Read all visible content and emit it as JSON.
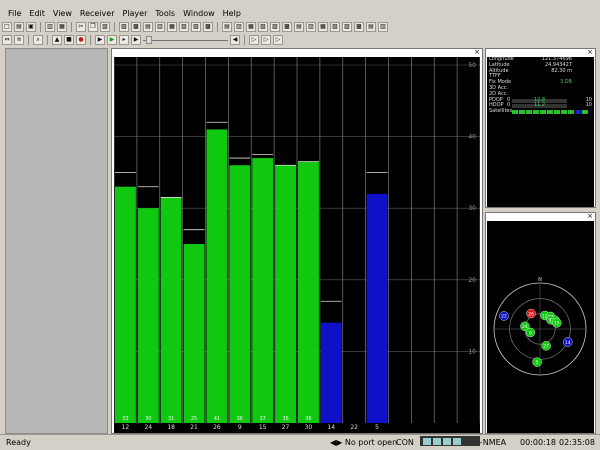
{
  "menu": [
    "File",
    "Edit",
    "View",
    "Receiver",
    "Player",
    "Tools",
    "Window",
    "Help"
  ],
  "toolbar1": [
    {
      "icon": "new-icon",
      "glyph": "□",
      "c": ""
    },
    {
      "icon": "open-icon",
      "glyph": "▤",
      "c": ""
    },
    {
      "icon": "save-icon",
      "glyph": "▣",
      "c": ""
    },
    {
      "sep": true
    },
    {
      "icon": "print-icon",
      "glyph": "▥",
      "c": ""
    },
    {
      "icon": "preview-icon",
      "glyph": "▦",
      "c": ""
    },
    {
      "sep": true
    },
    {
      "icon": "cut-icon",
      "glyph": "✂",
      "c": ""
    },
    {
      "icon": "copy-icon",
      "glyph": "❐",
      "c": ""
    },
    {
      "icon": "paste-icon",
      "glyph": "▧",
      "c": ""
    },
    {
      "sep": true
    },
    {
      "icon": "view1-icon",
      "glyph": "▨",
      "c": ""
    },
    {
      "icon": "view2-icon",
      "glyph": "▩",
      "c": ""
    },
    {
      "icon": "view3-icon",
      "glyph": "▤",
      "c": ""
    },
    {
      "icon": "view4-icon",
      "glyph": "▥",
      "c": ""
    },
    {
      "icon": "view5-icon",
      "glyph": "▦",
      "c": ""
    },
    {
      "icon": "view6-icon",
      "glyph": "▧",
      "c": ""
    },
    {
      "icon": "view7-icon",
      "glyph": "▨",
      "c": ""
    },
    {
      "icon": "view8-icon",
      "glyph": "▩",
      "c": ""
    },
    {
      "sep": true
    },
    {
      "icon": "tile1-icon",
      "glyph": "▤",
      "c": ""
    },
    {
      "icon": "tile2-icon",
      "glyph": "▥",
      "c": ""
    },
    {
      "icon": "tile3-icon",
      "glyph": "▦",
      "c": ""
    },
    {
      "icon": "tile4-icon",
      "glyph": "▧",
      "c": ""
    },
    {
      "icon": "tile5-icon",
      "glyph": "▨",
      "c": ""
    },
    {
      "icon": "tile6-icon",
      "glyph": "▩",
      "c": ""
    },
    {
      "icon": "tile7-icon",
      "glyph": "▤",
      "c": ""
    },
    {
      "icon": "tile8-icon",
      "glyph": "▥",
      "c": ""
    },
    {
      "icon": "tile9-icon",
      "glyph": "▦",
      "c": ""
    },
    {
      "icon": "tile10-icon",
      "glyph": "▧",
      "c": ""
    },
    {
      "icon": "tile11-icon",
      "glyph": "▨",
      "c": ""
    },
    {
      "icon": "tile12-icon",
      "glyph": "▩",
      "c": ""
    },
    {
      "icon": "tile13-icon",
      "glyph": "▤",
      "c": ""
    },
    {
      "icon": "tile14-icon",
      "glyph": "▥",
      "c": ""
    }
  ],
  "toolbar2": [
    {
      "icon": "connect-icon",
      "glyph": "⇔",
      "c": ""
    },
    {
      "icon": "baud-icon",
      "glyph": "≋",
      "c": ""
    },
    {
      "sep": true
    },
    {
      "icon": "search-icon",
      "glyph": "⌕",
      "c": ""
    },
    {
      "sep": true
    },
    {
      "icon": "eject-icon",
      "glyph": "▲",
      "c": "k"
    },
    {
      "icon": "stop-icon",
      "glyph": "■",
      "c": "k"
    },
    {
      "icon": "record-icon",
      "glyph": "●",
      "c": "r"
    },
    {
      "sep": true
    },
    {
      "icon": "step-icon",
      "glyph": "▶",
      "c": "k"
    },
    {
      "icon": "play-icon",
      "glyph": "▶",
      "c": "g"
    },
    {
      "icon": "fast-forward-icon",
      "glyph": "▸",
      "c": "k"
    },
    {
      "icon": "skip-icon",
      "glyph": "▶",
      "c": "k"
    }
  ],
  "toolbar2_tail": [
    {
      "icon": "rewind-icon",
      "glyph": "◀",
      "c": "k"
    },
    {
      "sep": true
    },
    {
      "icon": "marker1-icon",
      "glyph": "▷",
      "c": "k"
    },
    {
      "icon": "marker2-icon",
      "glyph": "▷",
      "c": "k"
    },
    {
      "icon": "marker3-icon",
      "glyph": "▷",
      "c": "k"
    }
  ],
  "colors": {
    "green": "#10c810",
    "blue": "#1010c8",
    "grid": "#6d6d6d"
  },
  "snr": {
    "axis_labels": [
      "50",
      "40",
      "30",
      "20",
      "10"
    ],
    "max": 50,
    "satellites": [
      {
        "prn": "12",
        "snr": 33,
        "peak": 35,
        "color": "green",
        "label": "33"
      },
      {
        "prn": "24",
        "snr": 30,
        "peak": 33,
        "color": "green",
        "label": "30"
      },
      {
        "prn": "18",
        "snr": 31.5,
        "peak": 31.5,
        "color": "green",
        "label": "31"
      },
      {
        "prn": "21",
        "snr": 25,
        "peak": 27,
        "color": "green",
        "label": "25"
      },
      {
        "prn": "26",
        "snr": 41,
        "peak": 42,
        "color": "green",
        "label": "41"
      },
      {
        "prn": "9",
        "snr": 36,
        "peak": 37,
        "color": "green",
        "label": "36"
      },
      {
        "prn": "15",
        "snr": 37,
        "peak": 37.5,
        "color": "green",
        "label": "37"
      },
      {
        "prn": "27",
        "snr": 36,
        "peak": 36,
        "color": "green",
        "label": "36"
      },
      {
        "prn": "30",
        "snr": 36.5,
        "peak": 36.5,
        "color": "green",
        "label": "36"
      },
      {
        "prn": "14",
        "snr": 14,
        "peak": 17,
        "color": "blue",
        "label": ""
      },
      {
        "prn": "22",
        "snr": 0,
        "peak": 0,
        "color": "blue",
        "label": ""
      },
      {
        "prn": "5",
        "snr": 32,
        "peak": 35,
        "color": "blue",
        "label": ""
      },
      {
        "prn": "",
        "snr": 0,
        "peak": 0,
        "color": "blue",
        "label": ""
      },
      {
        "prn": "",
        "snr": 0,
        "peak": 0,
        "color": "blue",
        "label": ""
      },
      {
        "prn": "",
        "snr": 0,
        "peak": 0,
        "color": "blue",
        "label": ""
      },
      {
        "prn": "",
        "snr": 0,
        "peak": 0,
        "color": "blue",
        "label": ""
      }
    ]
  },
  "info": {
    "rows": [
      {
        "label": "Longitude",
        "value": "121.374698"
      },
      {
        "label": "Latitude",
        "value": "24.943427"
      },
      {
        "label": "Altitude",
        "value": "82.30 m"
      },
      {
        "label": "TTFF",
        "value": ""
      },
      {
        "label": "Fix Mode",
        "value": "3 DB",
        "green": true
      },
      {
        "label": "3D Acc.",
        "value": ""
      },
      {
        "label": "2D Acc.",
        "value": ""
      }
    ],
    "pdop": {
      "label": "PDOP",
      "min": "0",
      "mid": "12.8",
      "max": "10",
      "fill": 0.4
    },
    "hdop": {
      "label": "HDOP",
      "min": "0",
      "mid": "11.2",
      "max": "10",
      "fill": 0.3
    },
    "sats_label": "Satellites"
  },
  "sky": {
    "north_label": "N",
    "sats": [
      {
        "prn": "26",
        "az": 330,
        "el": 55,
        "color": "#d81818"
      },
      {
        "prn": "12",
        "az": 20,
        "el": 62,
        "color": "#10c810"
      },
      {
        "prn": "18",
        "az": 40,
        "el": 58,
        "color": "#10c810"
      },
      {
        "prn": "30",
        "az": 50,
        "el": 62,
        "color": "#10c810"
      },
      {
        "prn": "21",
        "az": 60,
        "el": 56,
        "color": "#10c810"
      },
      {
        "prn": "15",
        "az": 70,
        "el": 55,
        "color": "#10c810"
      },
      {
        "prn": "24",
        "az": 280,
        "el": 60,
        "color": "#10c810"
      },
      {
        "prn": "9",
        "az": 250,
        "el": 70,
        "color": "#10c810"
      },
      {
        "prn": "27",
        "az": 160,
        "el": 55,
        "color": "#10c810"
      },
      {
        "prn": "5",
        "az": 185,
        "el": 25,
        "color": "#10c810"
      },
      {
        "prn": "14",
        "az": 115,
        "el": 30,
        "color": "#1010c8"
      },
      {
        "prn": "22",
        "az": 290,
        "el": 15,
        "color": "#1010c8"
      }
    ]
  },
  "status": {
    "ready": "Ready",
    "port": "◀▶ No port open",
    "con": "CON",
    "nmea": "~NMEA",
    "time1": "00:00:18",
    "time2": "02:35:08"
  }
}
